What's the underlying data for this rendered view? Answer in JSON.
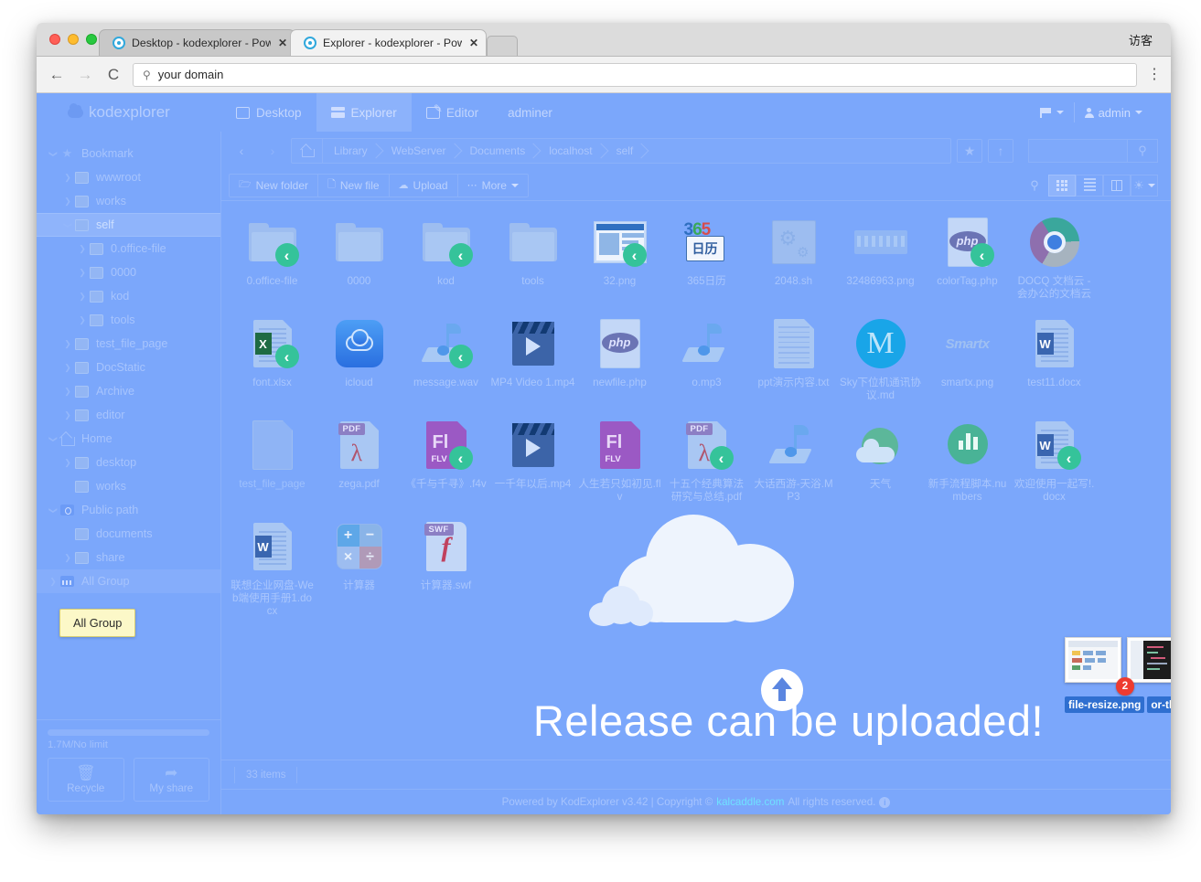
{
  "browser": {
    "guest_label": "访客",
    "tabs": [
      {
        "title": "Desktop - kodexplorer - Power",
        "active": false,
        "close": "✕",
        "favicon": "kod-favicon"
      },
      {
        "title": "Explorer - kodexplorer - Power",
        "active": true,
        "close": "✕",
        "favicon": "kod-favicon"
      }
    ],
    "back_icon": "←",
    "forward_icon": "→",
    "reload_icon": "C",
    "menu_icon": "⋮",
    "url_search_icon": "search-icon",
    "url_value": "your domain"
  },
  "app": {
    "logo_text": "kodexplorer",
    "nav": [
      {
        "label": "Desktop",
        "icon": "desktop-icon",
        "active": false
      },
      {
        "label": "Explorer",
        "icon": "explorer-icon",
        "active": true
      },
      {
        "label": "Editor",
        "icon": "editor-icon",
        "active": false
      },
      {
        "label": "adminer",
        "icon": "",
        "active": false
      }
    ],
    "user_menu": "admin",
    "flag_icon": "flag-icon"
  },
  "sidebar": {
    "tree": [
      {
        "label": "Bookmark",
        "indent": 0,
        "arrow": "open",
        "icon": "star-icon",
        "selected": false
      },
      {
        "label": "wwwroot",
        "indent": 1,
        "arrow": "closed",
        "icon": "folder-icon",
        "selected": false
      },
      {
        "label": "works",
        "indent": 1,
        "arrow": "closed",
        "icon": "folder-icon",
        "selected": false
      },
      {
        "label": "self",
        "indent": 1,
        "arrow": "open",
        "icon": "folder-icon",
        "selected": true
      },
      {
        "label": "0.office-file",
        "indent": 2,
        "arrow": "closed",
        "icon": "folder-icon",
        "selected": false
      },
      {
        "label": "0000",
        "indent": 2,
        "arrow": "closed",
        "icon": "folder-icon",
        "selected": false
      },
      {
        "label": "kod",
        "indent": 2,
        "arrow": "closed",
        "icon": "folder-icon",
        "selected": false
      },
      {
        "label": "tools",
        "indent": 2,
        "arrow": "closed",
        "icon": "folder-icon",
        "selected": false
      },
      {
        "label": "test_file_page",
        "indent": 1,
        "arrow": "closed",
        "icon": "folder-icon",
        "selected": false
      },
      {
        "label": "DocStatic",
        "indent": 1,
        "arrow": "closed",
        "icon": "folder-icon",
        "selected": false
      },
      {
        "label": "Archive",
        "indent": 1,
        "arrow": "closed",
        "icon": "folder-icon",
        "selected": false
      },
      {
        "label": "editor",
        "indent": 1,
        "arrow": "closed",
        "icon": "folder-icon",
        "selected": false
      },
      {
        "label": "Home",
        "indent": 0,
        "arrow": "open",
        "icon": "home-icon",
        "selected": false
      },
      {
        "label": "desktop",
        "indent": 1,
        "arrow": "closed",
        "icon": "folder-icon",
        "selected": false
      },
      {
        "label": "works",
        "indent": 1,
        "arrow": "none",
        "icon": "folder-icon",
        "selected": false
      },
      {
        "label": "Public path",
        "indent": 0,
        "arrow": "open",
        "icon": "public-icon",
        "selected": false
      },
      {
        "label": "documents",
        "indent": 1,
        "arrow": "none",
        "icon": "folder-icon",
        "selected": false
      },
      {
        "label": "share",
        "indent": 1,
        "arrow": "closed",
        "icon": "folder-icon",
        "selected": false
      },
      {
        "label": "All Group",
        "indent": 0,
        "arrow": "closed",
        "icon": "group-icon",
        "selected": false,
        "hovered": true
      }
    ],
    "tooltip": "All Group",
    "storage_text": "1.7M/No limit",
    "footer_buttons": [
      {
        "label": "Recycle",
        "icon": "trash-icon"
      },
      {
        "label": "My share",
        "icon": "share-icon"
      }
    ]
  },
  "pathbar": {
    "back_icon": "‹",
    "forward_icon": "›",
    "home_icon": "home-icon",
    "crumbs": [
      "Library",
      "WebServer",
      "Documents",
      "localhost",
      "self"
    ],
    "favorite_icon": "star-icon",
    "up_icon": "↑",
    "search_placeholder": "",
    "search_icon": "search-icon"
  },
  "toolbar": {
    "buttons": [
      {
        "label": "New folder",
        "icon": "folder-plus-icon"
      },
      {
        "label": "New file",
        "icon": "file-plus-icon"
      },
      {
        "label": "Upload",
        "icon": "upload-cloud-icon"
      },
      {
        "label": "More",
        "icon": "ellipsis-icon",
        "caret": true
      }
    ],
    "view_icons": [
      {
        "name": "zoom-icon",
        "active": false,
        "boxed": false
      },
      {
        "name": "grid-view-icon",
        "active": true,
        "boxed": true
      },
      {
        "name": "list-view-icon",
        "active": false,
        "boxed": true
      },
      {
        "name": "split-view-icon",
        "active": false,
        "boxed": true
      },
      {
        "name": "theme-icon",
        "active": false,
        "boxed": true,
        "caret": true
      }
    ]
  },
  "files": [
    {
      "name": "0.office-file",
      "type": "folder",
      "shared": true
    },
    {
      "name": "0000",
      "type": "folder",
      "shared": false
    },
    {
      "name": "kod",
      "type": "folder",
      "shared": true
    },
    {
      "name": "tools",
      "type": "folder",
      "shared": false
    },
    {
      "name": "32.png",
      "type": "screenshot",
      "shared": true
    },
    {
      "name": "365日历",
      "type": "calendar365",
      "shared": false
    },
    {
      "name": "2048.sh",
      "type": "shell",
      "shared": false
    },
    {
      "name": "32486963.png",
      "type": "pngwide",
      "shared": false
    },
    {
      "name": "colorTag.php",
      "type": "php",
      "shared": true
    },
    {
      "name": "DOCQ 文档云 - 会办公的文档云",
      "type": "chrome",
      "shared": false
    },
    {
      "name": "font.xlsx",
      "type": "excel",
      "shared": true
    },
    {
      "name": "icloud",
      "type": "icloud",
      "shared": false
    },
    {
      "name": "message.wav",
      "type": "music",
      "shared": true
    },
    {
      "name": "MP4 Video 1.mp4",
      "type": "video",
      "shared": false
    },
    {
      "name": "newfile.php",
      "type": "php",
      "shared": false
    },
    {
      "name": "o.mp3",
      "type": "music",
      "shared": false
    },
    {
      "name": "ppt演示内容.txt",
      "type": "text",
      "shared": false
    },
    {
      "name": "Sky下位机通讯协议.md",
      "type": "mdcircle",
      "shared": false
    },
    {
      "name": "smartx.png",
      "type": "smartx",
      "shared": false
    },
    {
      "name": "test11.docx",
      "type": "word",
      "shared": false
    },
    {
      "name": "test_file_page",
      "type": "blank",
      "shared": false,
      "link": true
    },
    {
      "name": "zega.pdf",
      "type": "pdf",
      "shared": false
    },
    {
      "name": "《千与千寻》.f4v",
      "type": "flv",
      "shared": true
    },
    {
      "name": "一千年以后.mp4",
      "type": "video",
      "shared": false
    },
    {
      "name": "人生若只如初见.flv",
      "type": "flv",
      "shared": false
    },
    {
      "name": "十五个经典算法研究与总结.pdf",
      "type": "pdf",
      "shared": true
    },
    {
      "name": "大话西游-天浴.MP3",
      "type": "music",
      "shared": false
    },
    {
      "name": "天气",
      "type": "weather",
      "shared": false
    },
    {
      "name": "新手流程脚本.numbers",
      "type": "numbers",
      "shared": false
    },
    {
      "name": "欢迎使用一起写!.docx",
      "type": "word",
      "shared": true
    },
    {
      "name": "联想企业网盘-Web端使用手册1.docx",
      "type": "word",
      "shared": false
    },
    {
      "name": "计算器",
      "type": "calculator",
      "shared": false
    },
    {
      "name": "计算器.swf",
      "type": "swf",
      "shared": false
    }
  ],
  "drop_overlay": {
    "text": "Release can be uploaded!",
    "cloud_icon": "cloud-icon",
    "upload_arrow_icon": "upload-arrow-icon"
  },
  "drag_ghost": {
    "count": "2",
    "labels": [
      "file-resize.png",
      "or-theme.png"
    ]
  },
  "statusbar": {
    "items_count": "33 items"
  },
  "footer": {
    "prefix": "Powered by KodExplorer v3.42 | Copyright ©",
    "link": "kalcaddle.com",
    "suffix": "All rights reserved.",
    "info_icon": "info-icon"
  }
}
